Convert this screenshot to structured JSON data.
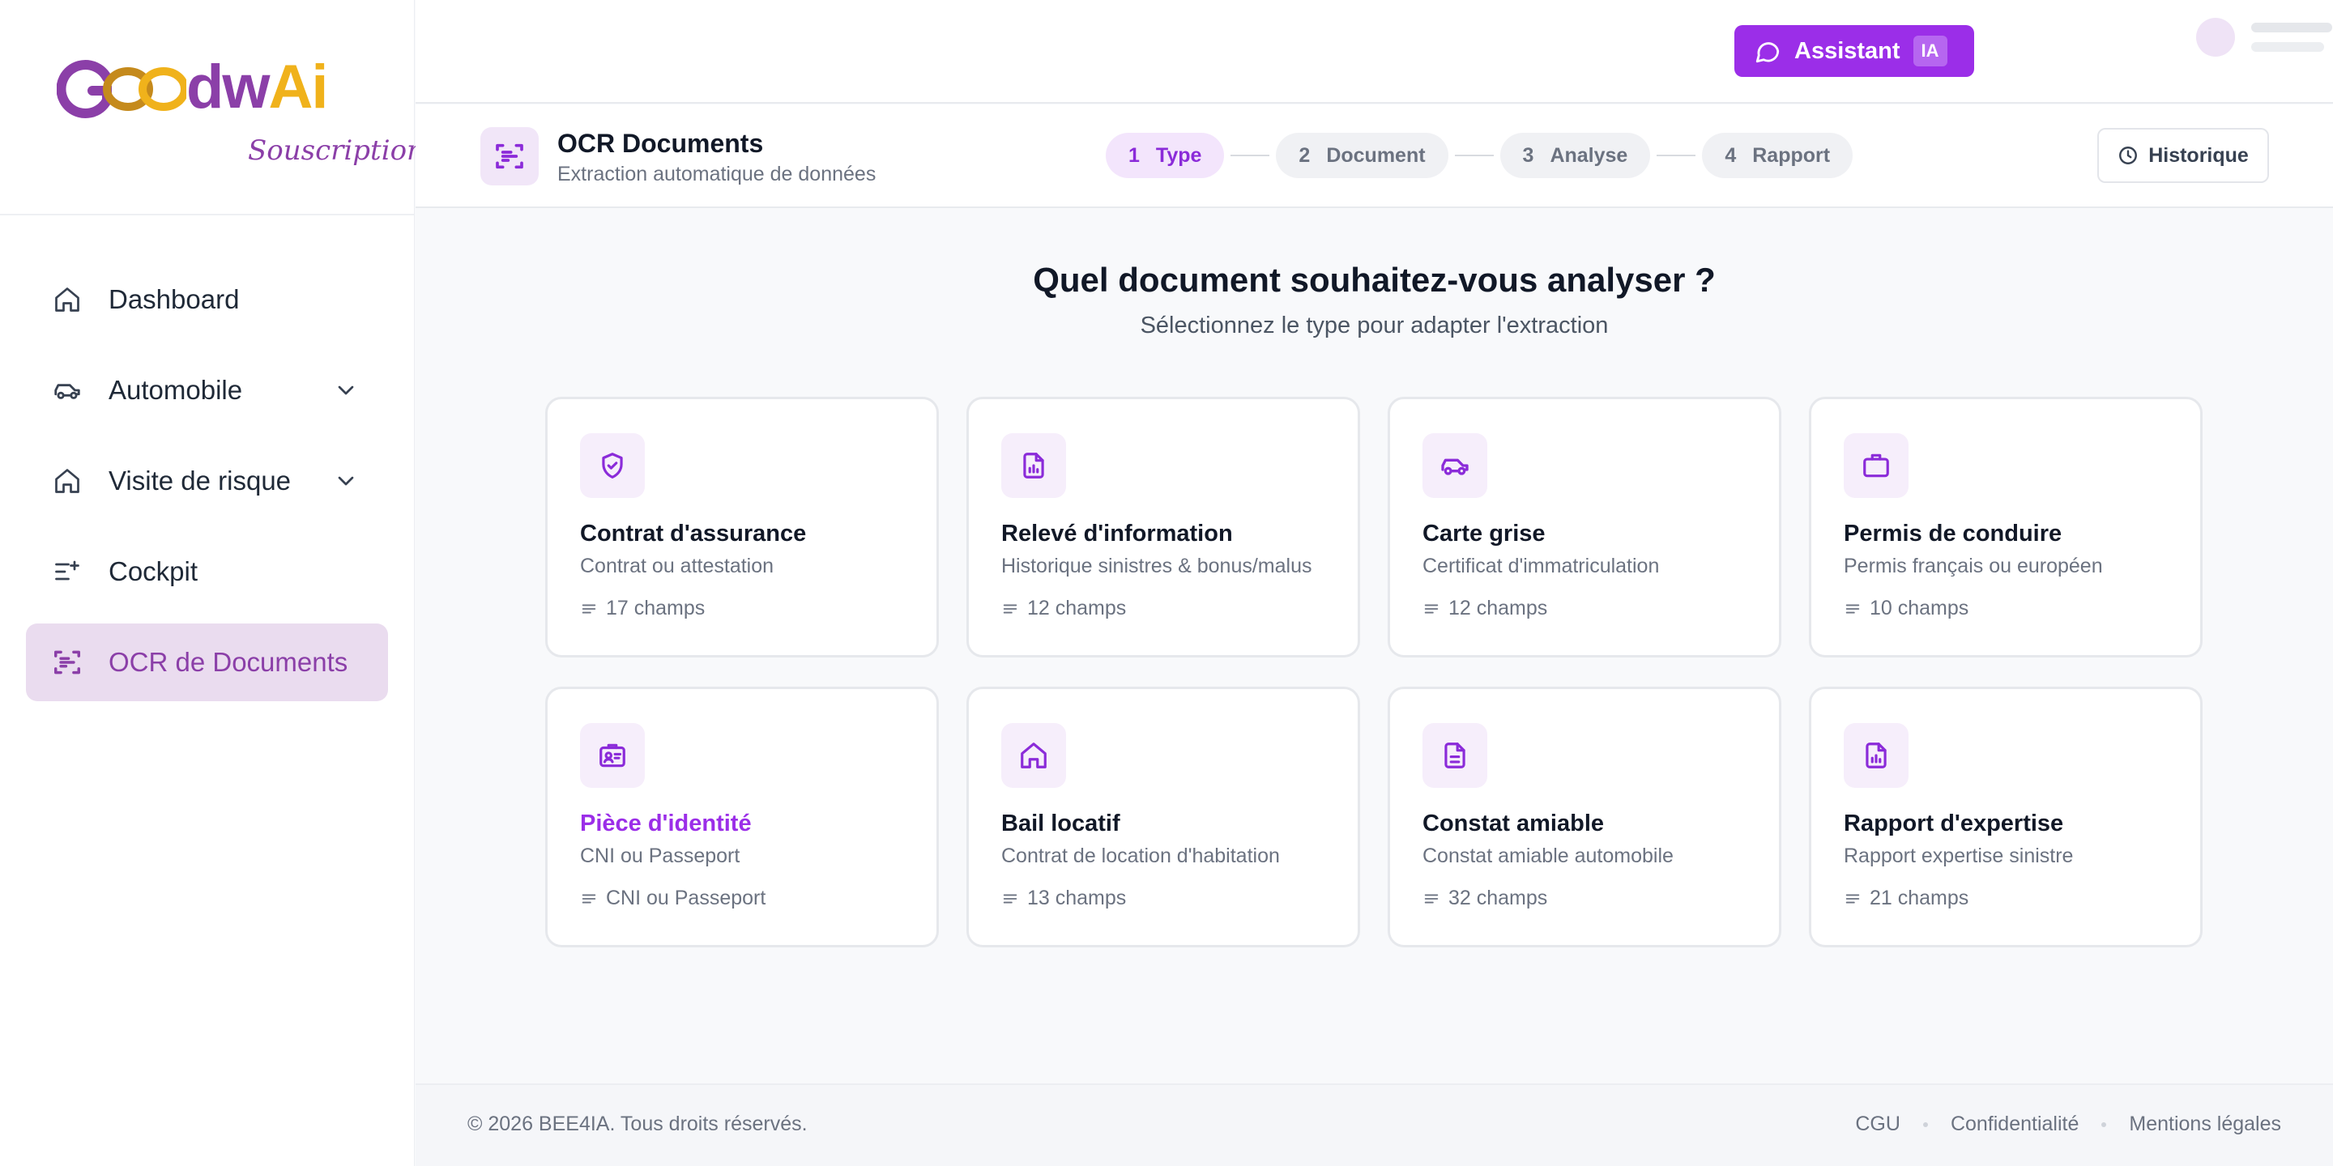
{
  "brand": {
    "logo_goo": "Goo",
    "logo_dw": "dw",
    "logo_ai": "Ai",
    "subtitle": "Souscription",
    "color_purple": "#8b3fa8",
    "color_gold": "#f0b21b"
  },
  "sidebar": {
    "items": [
      {
        "label": "Dashboard",
        "icon": "home-icon"
      },
      {
        "label": "Automobile",
        "icon": "car-icon",
        "expandable": true
      },
      {
        "label": "Visite de risque",
        "icon": "home-icon",
        "expandable": true
      },
      {
        "label": "Cockpit",
        "icon": "list-sparkle-icon"
      },
      {
        "label": "OCR de Documents",
        "icon": "scan-icon",
        "active": true
      }
    ]
  },
  "topbar": {
    "assistant_label": "Assistant",
    "assistant_badge": "IA",
    "accent": "#9b2ee8"
  },
  "page_header": {
    "title": "OCR Documents",
    "subtitle": "Extraction automatique de données",
    "history_label": "Historique",
    "steps": [
      {
        "num": "1",
        "label": "Type",
        "active": true
      },
      {
        "num": "2",
        "label": "Document"
      },
      {
        "num": "3",
        "label": "Analyse"
      },
      {
        "num": "4",
        "label": "Rapport"
      }
    ]
  },
  "main": {
    "title": "Quel document souhaitez-vous analyser ?",
    "subtitle": "Sélectionnez le type pour adapter l'extraction",
    "cards": [
      {
        "title": "Contrat d'assurance",
        "subtitle": "Contrat ou attestation",
        "meta": "17 champs",
        "icon": "shield-check-icon"
      },
      {
        "title": "Relevé d'information",
        "subtitle": "Historique sinistres & bonus/malus",
        "meta": "12 champs",
        "icon": "file-chart-icon"
      },
      {
        "title": "Carte grise",
        "subtitle": "Certificat d'immatriculation",
        "meta": "12 champs",
        "icon": "car-icon"
      },
      {
        "title": "Permis de conduire",
        "subtitle": "Permis français ou européen",
        "meta": "10 champs",
        "icon": "id-badge-icon"
      },
      {
        "title": "Pièce d'identité",
        "subtitle": "CNI ou Passeport",
        "meta": "CNI ou Passeport",
        "icon": "id-card-icon",
        "selected": true
      },
      {
        "title": "Bail locatif",
        "subtitle": "Contrat de location d'habitation",
        "meta": "13 champs",
        "icon": "home-icon"
      },
      {
        "title": "Constat amiable",
        "subtitle": "Constat amiable automobile",
        "meta": "32 champs",
        "icon": "file-text-icon"
      },
      {
        "title": "Rapport d'expertise",
        "subtitle": "Rapport expertise sinistre",
        "meta": "21 champs",
        "icon": "file-chart-icon"
      }
    ]
  },
  "footer": {
    "copyright": "© 2026 BEE4IA. Tous droits réservés.",
    "links": [
      "CGU",
      "Confidentialité",
      "Mentions légales"
    ]
  }
}
